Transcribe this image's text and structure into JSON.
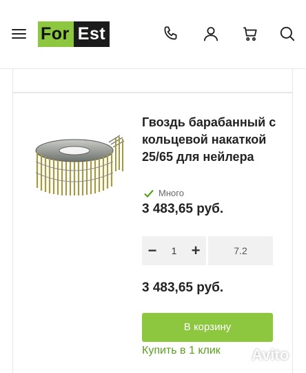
{
  "header": {
    "logo": {
      "left": "For",
      "right": "Est"
    },
    "icons": [
      "menu-icon",
      "phone-icon",
      "user-icon",
      "cart-icon",
      "search-icon"
    ]
  },
  "colors": {
    "brand_green": "#8dc63f",
    "logo_dark": "#1b1b1b",
    "link_green": "#5a9e1f",
    "field_bg": "#f1f1f1"
  },
  "product": {
    "title": "Гвоздь барабанный с кольцевой накаткой 25/65 для нейлера",
    "stock_label": "Много",
    "price": "3 483,65 руб.",
    "quantity": "1",
    "unit_value": "7.2",
    "total_price": "3 483,65 руб.",
    "add_to_cart_label": "В корзину",
    "buy_one_click_label": "Купить в 1 клик"
  },
  "watermark": {
    "text": "Avito"
  }
}
